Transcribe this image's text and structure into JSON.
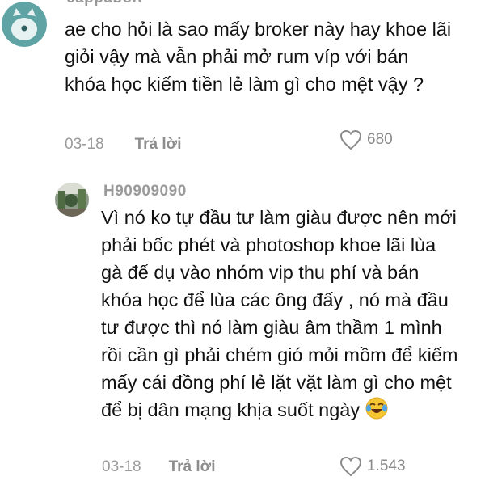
{
  "comments": [
    {
      "username": "cappabon",
      "avatar": "cat-avatar-icon",
      "text": "ae cho hỏi là sao mấy broker này hay khoe lãi giỏi vậy mà vẫn phải mở rum víp với bán khóa học kiếm tiền lẻ làm gì cho mệt vậy ?",
      "date": "03-18",
      "reply_label": "Trả lời",
      "likes": "680"
    },
    {
      "username": "H90909090",
      "avatar": "photo-avatar-icon",
      "text": "Vì nó ko tự đầu tư làm giàu được nên mới phải bốc phét và photoshop khoe lãi lùa gà để dụ vào nhóm vip thu phí và bán khóa học để lùa các ông đấy , nó mà đầu tư được thì nó làm giàu âm thầm 1 mình rồi cần gì phải chém gió mỏi mồm để kiếm mấy cái đồng phí lẻ lặt vặt làm gì cho mệt để bị dân mạng khịa suốt ngày",
      "emoji": "laughing-tears-emoji",
      "date": "03-18",
      "reply_label": "Trả lời",
      "likes": "1.543"
    }
  ],
  "colors": {
    "text": "#111111",
    "muted": "#9a9a9a",
    "avatar_teal": "#5fa3a5"
  }
}
